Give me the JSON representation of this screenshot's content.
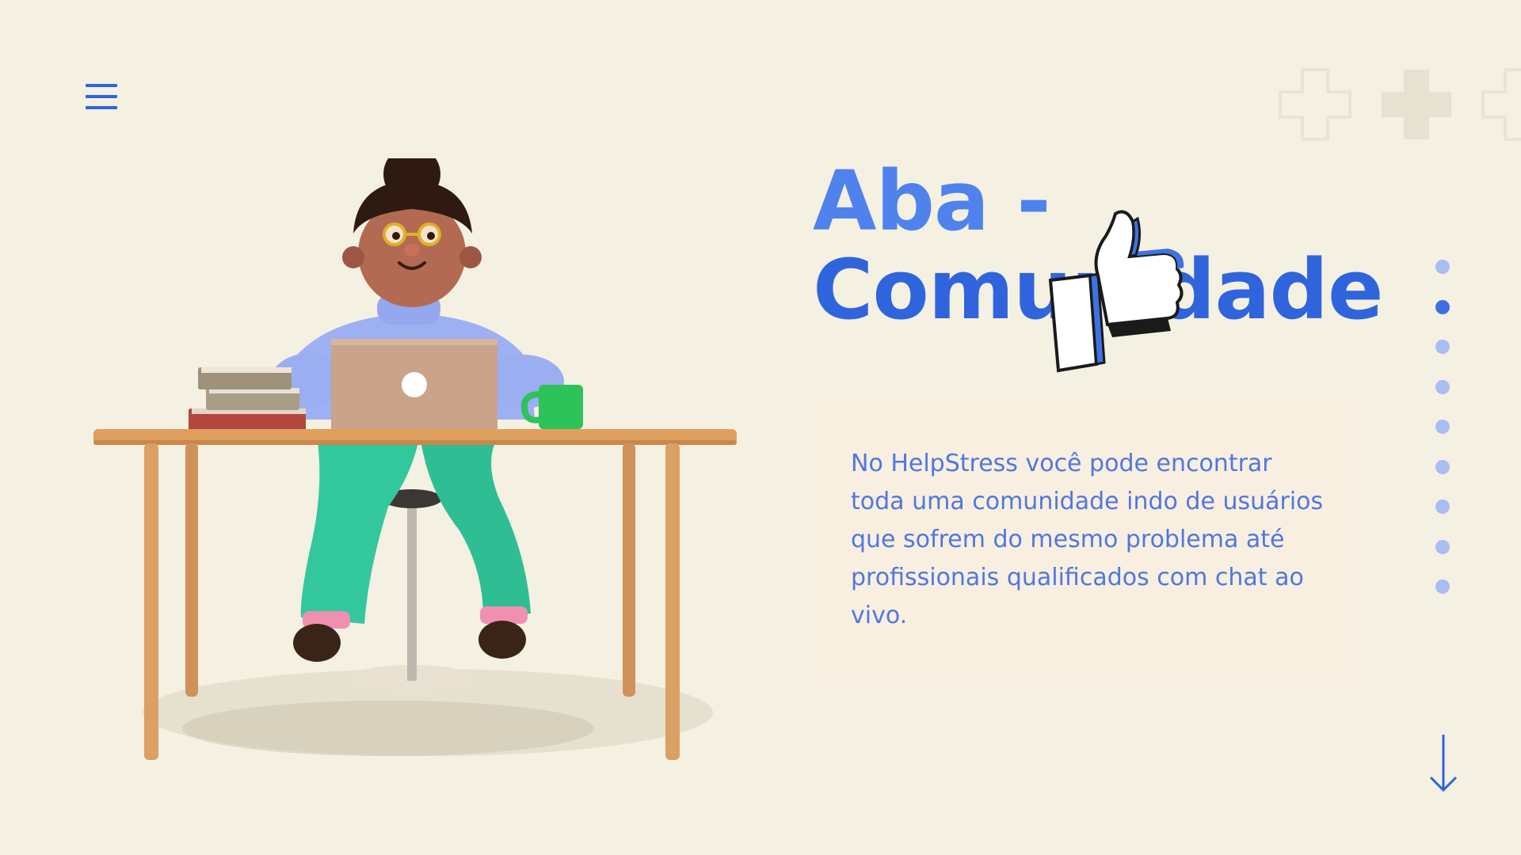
{
  "nav": {
    "menu_icon": "hamburger-menu-icon"
  },
  "headline": {
    "line1": "Aba -",
    "line2": "Comunidade"
  },
  "card": {
    "text": "No HelpStress você pode encontrar toda uma comunidade indo de usuários que sofrem do mesmo problema até profissionais qualificados com chat ao vivo."
  },
  "pagination": {
    "total": 9,
    "active_index": 1
  },
  "icons": {
    "scroll": "arrow-down-icon",
    "thumb": "thumbs-up-icon",
    "crosses": "plus-icon"
  },
  "colors": {
    "background": "#f4f0e2",
    "accent": "#2f64dd",
    "accent_light": "#4f82ec",
    "card_bg": "#f8efe0",
    "dot_inactive": "#a9bdf0",
    "dot_active": "#3f6fe0"
  }
}
